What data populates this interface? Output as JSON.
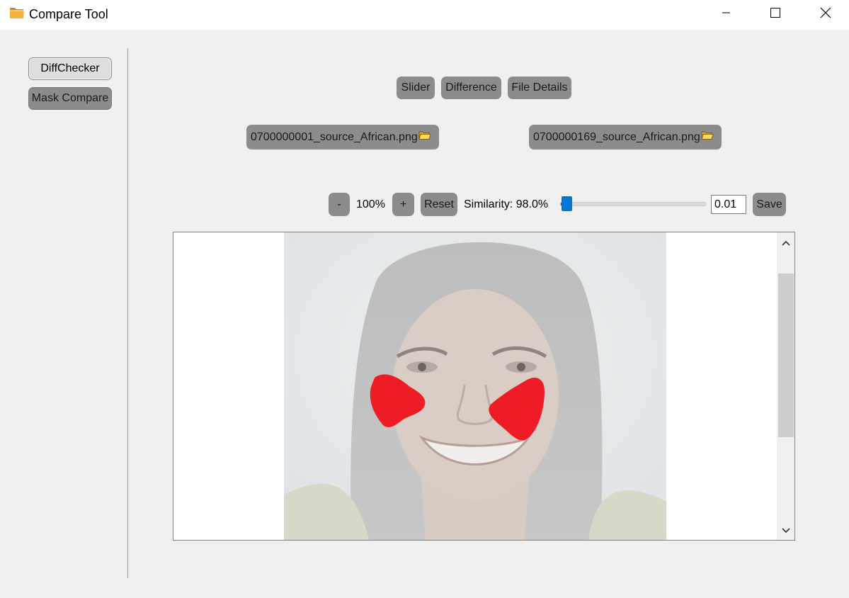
{
  "window": {
    "title": "Compare Tool",
    "icon": "folder-icon",
    "controls": [
      "minimize-icon",
      "maximize-icon",
      "close-icon"
    ]
  },
  "sidebar": {
    "items": [
      {
        "label": "DiffChecker",
        "active": true
      },
      {
        "label": "Mask Compare",
        "active": false
      }
    ]
  },
  "tabs": [
    {
      "label": "Slider"
    },
    {
      "label": "Difference"
    },
    {
      "label": "File Details"
    }
  ],
  "files": {
    "left": "0700000001_source_African.png",
    "right": "0700000169_source_African.png"
  },
  "toolbar": {
    "zoom_out": "-",
    "zoom_level": "100%",
    "zoom_in": "+",
    "reset": "Reset",
    "similarity": "Similarity: 98.0%",
    "threshold_fraction": 0.01,
    "threshold_value": "0.01",
    "save": "Save"
  },
  "viewer": {
    "content": "mask overlay on portrait",
    "mask_color": "#ee1c25"
  },
  "colors": {
    "button_gray": "#8c8c8c",
    "slider_accent": "#0078d7",
    "background": "#f0f0f0"
  }
}
